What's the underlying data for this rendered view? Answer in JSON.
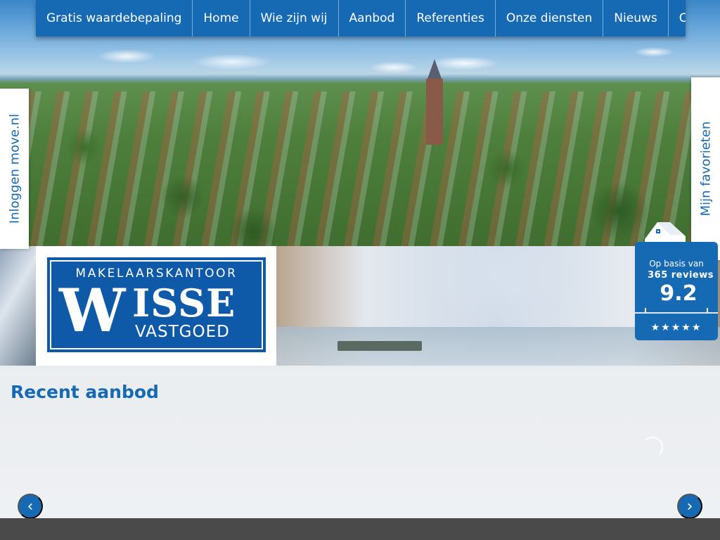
{
  "nav": {
    "items": [
      {
        "label": "Gratis waardebepaling"
      },
      {
        "label": "Home"
      },
      {
        "label": "Wie zijn wij"
      },
      {
        "label": "Aanbod"
      },
      {
        "label": "Referenties"
      },
      {
        "label": "Onze diensten"
      },
      {
        "label": "Nieuws"
      },
      {
        "label": "Contact"
      }
    ]
  },
  "logo": {
    "line1": "MAKELAARSKANTOOR",
    "letter_w": "W",
    "word_isse": "ISSE",
    "line3": "VASTGOED"
  },
  "side_tabs": {
    "left": "Inloggen move.nl",
    "right": "Mijn favorieten"
  },
  "review_badge": {
    "basis": "Op basis van",
    "reviews": "365 reviews",
    "score": "9.2",
    "stars": "★★★★★",
    "color": "#1669b3"
  },
  "section": {
    "title": "Recent aanbod"
  },
  "carousel": {
    "prev_icon": "‹",
    "next_icon": "›"
  },
  "colors": {
    "brand": "#1669b3",
    "footer": "#4a4a4a"
  }
}
